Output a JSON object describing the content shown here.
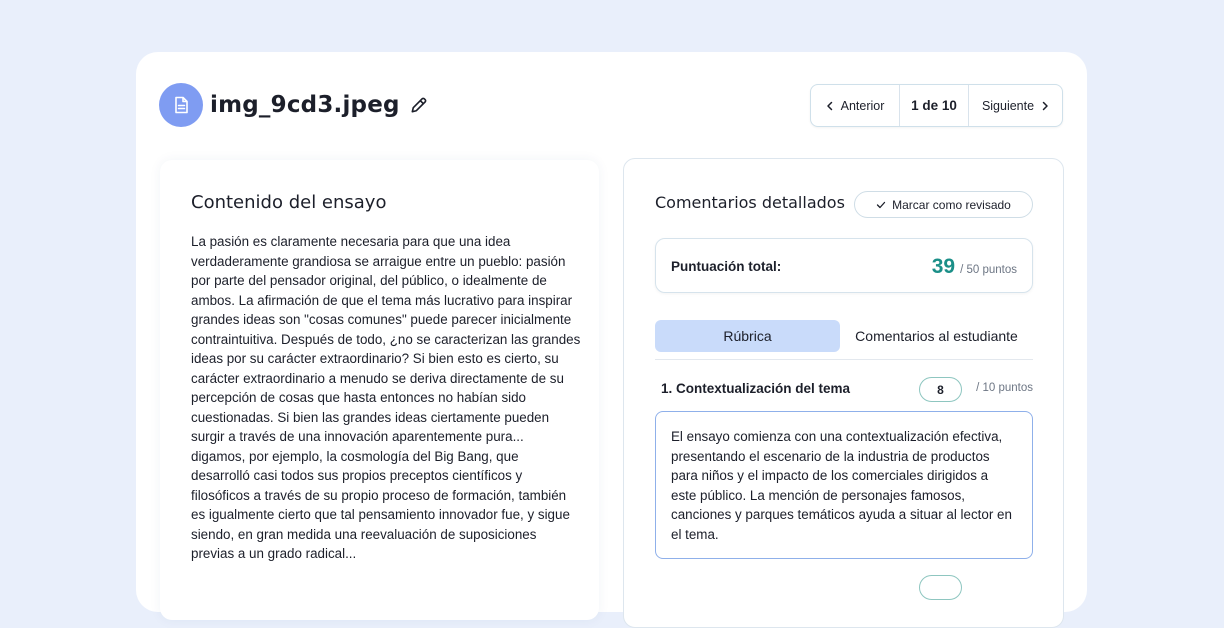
{
  "header": {
    "file_icon": "document-icon",
    "file_name": "img_9cd3.jpeg",
    "edit_icon": "pencil-icon"
  },
  "pager": {
    "prev_label": "Anterior",
    "count_label": "1 de 10",
    "next_label": "Siguiente"
  },
  "essay": {
    "heading": "Contenido del ensayo",
    "text": "La pasión es claramente necesaria para que una idea verdaderamente grandiosa se arraigue entre un pueblo: pasión por parte del pensador original, del público, o idealmente de ambos. La afirmación de que el tema más lucrativo para inspirar grandes ideas son \"cosas comunes\" puede parecer inicialmente contraintuitiva. Después de todo, ¿no se caracterizan las grandes ideas por su carácter extraordinario? Si bien esto es cierto, su carácter extraordinario a menudo se deriva directamente de su percepción de cosas que hasta entonces no habían sido cuestionadas. Si bien las grandes ideas ciertamente pueden surgir a través de una innovación aparentemente pura... digamos, por ejemplo, la cosmología del Big Bang, que desarrolló casi todos sus propios preceptos científicos y filosóficos a través de su propio proceso de formación, también es igualmente cierto que tal pensamiento innovador fue, y sigue siendo, en gran medida una reevaluación de suposiciones previas a un grado radical..."
  },
  "feedback": {
    "heading": "Comentarios detallados",
    "mark_reviewed_label": "Marcar como revisado",
    "score_label": "Puntuación total:",
    "score_value": "39",
    "score_max": "/ 50 puntos",
    "tabs": [
      {
        "label": "Rúbrica",
        "active": true
      },
      {
        "label": "Comentarios al estudiante",
        "active": false
      }
    ],
    "criteria": [
      {
        "title": "1. Contextualización del tema",
        "score": "8",
        "max": "/ 10 puntos",
        "comment": "El ensayo comienza con una contextualización efectiva, presentando el escenario de la industria de productos para niños y el impacto de los comerciales dirigidos a este público. La mención de personajes famosos, canciones y parques temáticos ayuda a situar al lector en el tema."
      }
    ]
  },
  "colors": {
    "background": "#e9effb",
    "accent": "#7f9cf2",
    "score": "#1b8f88",
    "active_tab": "#c9dbfa"
  }
}
